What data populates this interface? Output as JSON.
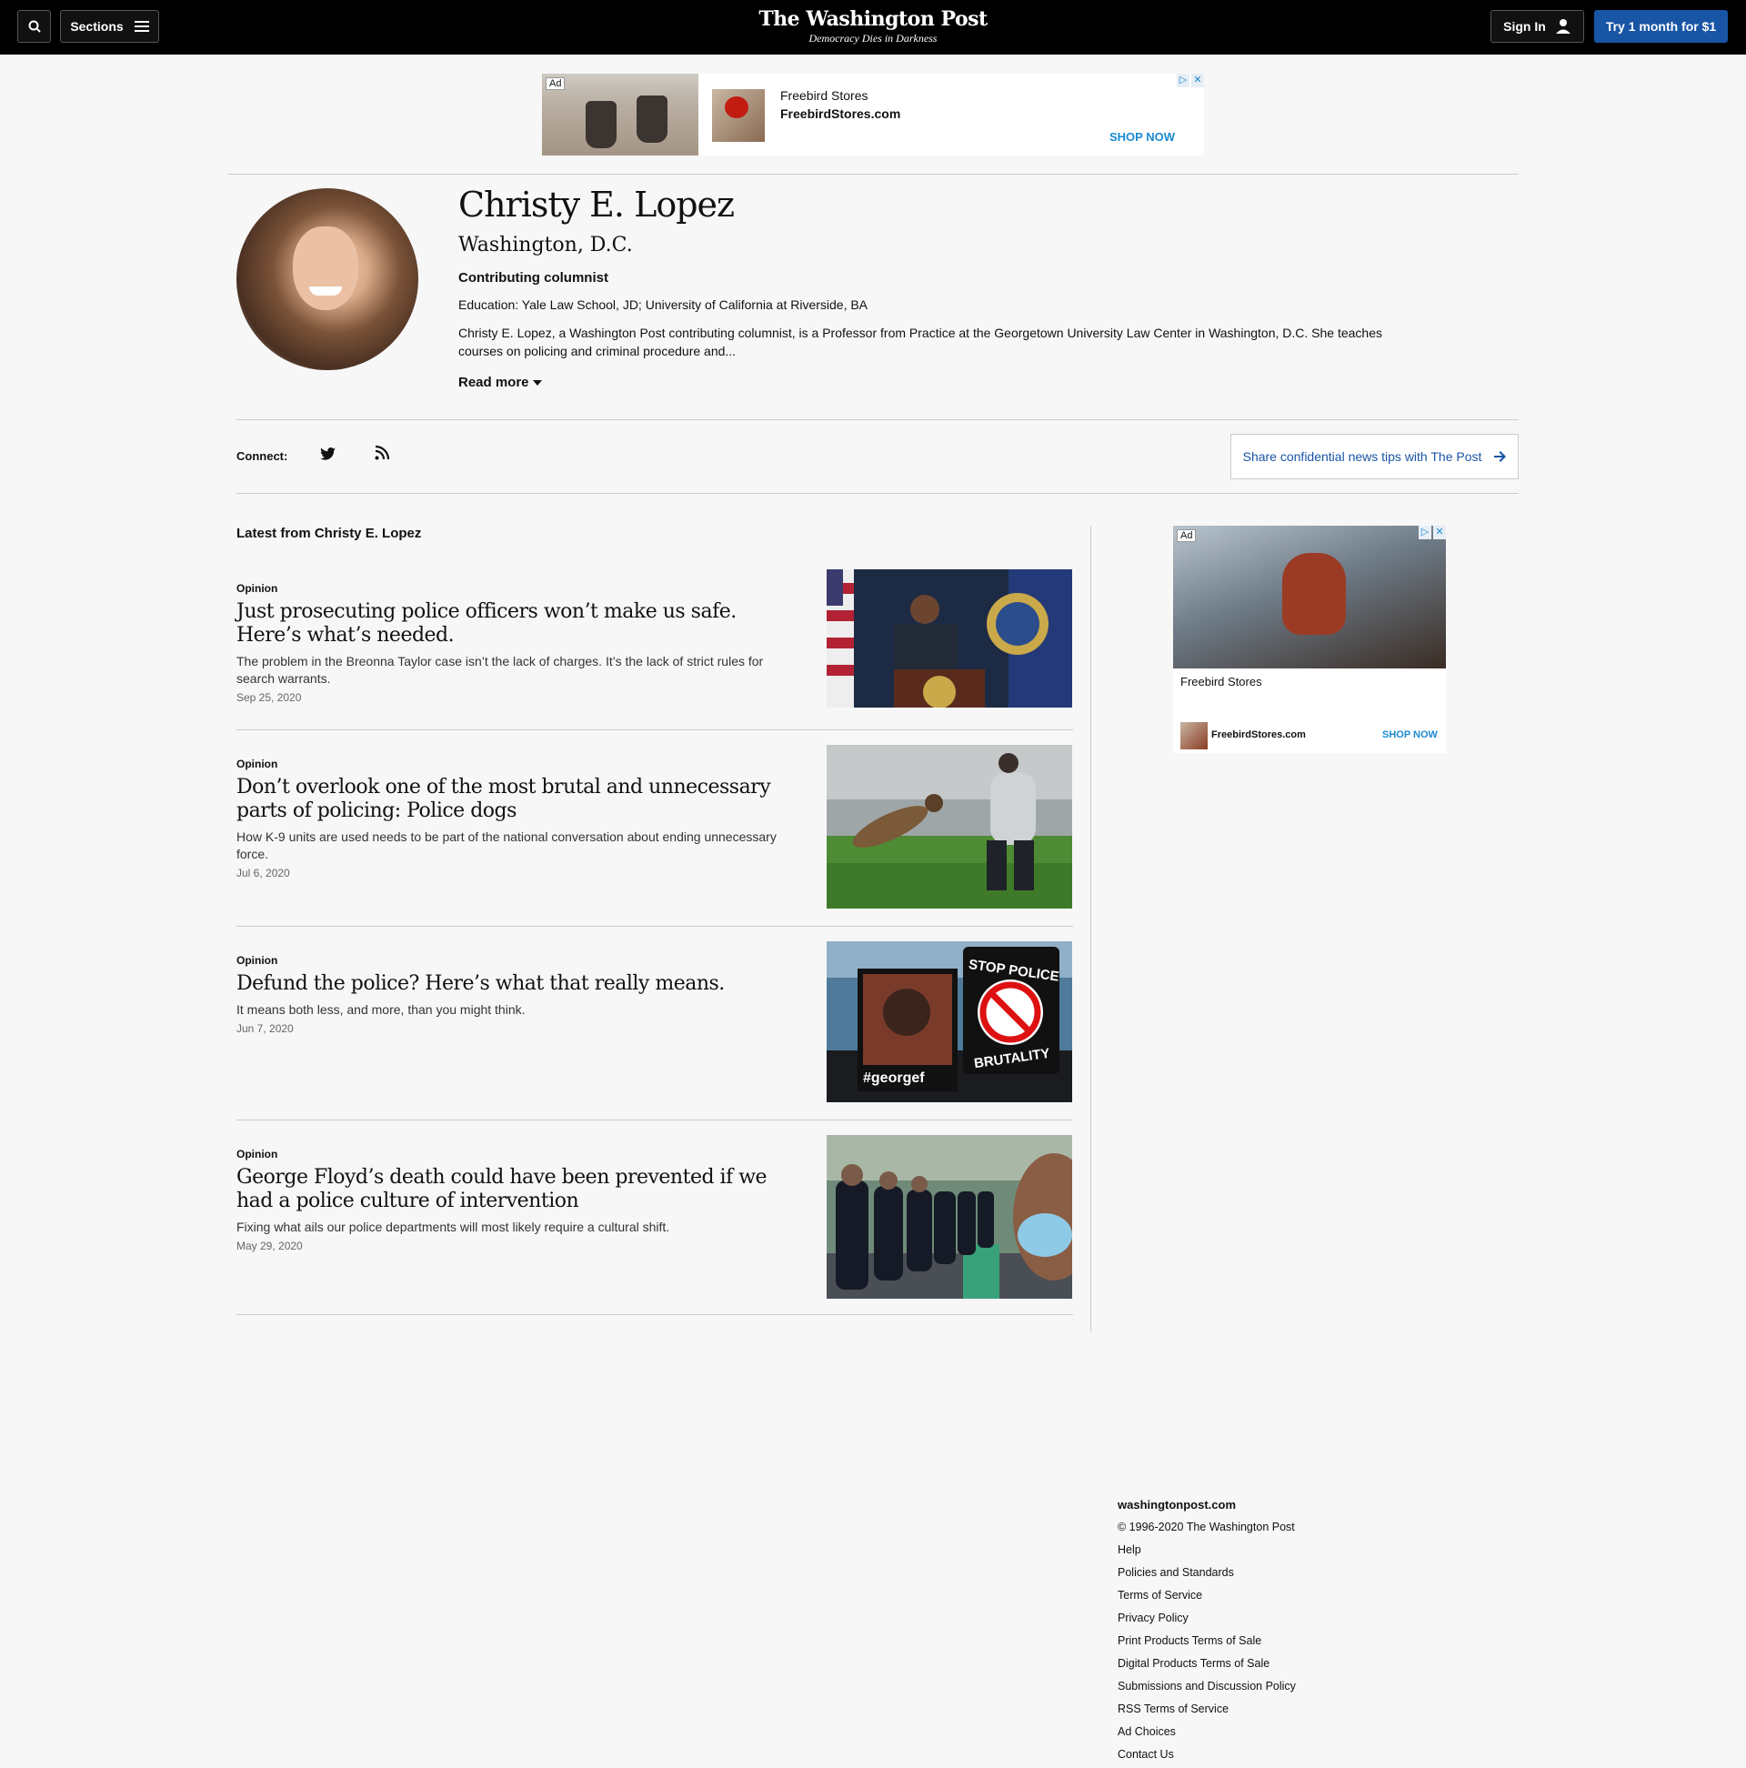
{
  "header": {
    "sections_label": "Sections",
    "logo": "The Washington Post",
    "tagline": "Democracy Dies in Darkness",
    "signin_label": "Sign In",
    "try_label": "Try 1 month for $1"
  },
  "ad_top": {
    "label": "Ad",
    "advertiser": "Freebird Stores",
    "url": "FreebirdStores.com",
    "cta": "SHOP NOW"
  },
  "profile": {
    "name": "Christy E. Lopez",
    "city": "Washington, D.C.",
    "role": "Contributing columnist",
    "education": "Education: Yale Law School, JD; University of California at Riverside, BA",
    "bio": "Christy E. Lopez, a Washington Post contributing columnist, is a Professor from Practice at the Georgetown University Law Center in Washington, D.C. She teaches courses on policing and criminal procedure and...",
    "read_more": "Read more"
  },
  "connect": {
    "label": "Connect:",
    "tips_label": "Share confidential news tips with The Post"
  },
  "latest_label": "Latest from Christy E. Lopez",
  "articles": [
    {
      "kicker": "Opinion",
      "title": "Just prosecuting police officers won’t make us safe. Here’s what’s needed.",
      "description": "The problem in the Breonna Taylor case isn’t the lack of charges. It’s the lack of strict rules for search warrants.",
      "date": "Sep 25, 2020"
    },
    {
      "kicker": "Opinion",
      "title": "Don’t overlook one of the most brutal and unnecessary parts of policing: Police dogs",
      "description": "How K-9 units are used needs to be part of the national conversation about ending unnecessary force.",
      "date": "Jul 6, 2020"
    },
    {
      "kicker": "Opinion",
      "title": "Defund the police? Here’s what that really means.",
      "description": "It means both less, and more, than you might think.",
      "date": "Jun 7, 2020",
      "image_text_1": "STOP POLICE",
      "image_text_2": "BRUTALITY",
      "image_text_3": "#georgef"
    },
    {
      "kicker": "Opinion",
      "title": "George Floyd’s death could have been prevented if we had a police culture of intervention",
      "description": "Fixing what ails our police departments will most likely require a cultural shift.",
      "date": "May 29, 2020"
    }
  ],
  "ad_side": {
    "label": "Ad",
    "advertiser": "Freebird Stores",
    "url": "FreebirdStores.com",
    "cta": "SHOP NOW"
  },
  "footer": {
    "site": "washingtonpost.com",
    "copyright": "© 1996-2020 The Washington Post",
    "links": [
      "Help",
      "Policies and Standards",
      "Terms of Service",
      "Privacy Policy",
      "Print Products Terms of Sale",
      "Digital Products Terms of Sale",
      "Submissions and Discussion Policy",
      "RSS Terms of Service",
      "Ad Choices",
      "Contact Us"
    ]
  }
}
